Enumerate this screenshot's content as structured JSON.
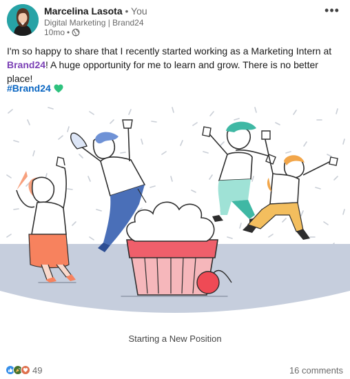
{
  "author": {
    "name": "Marcelina Lasota",
    "separator": "•",
    "degree": "You",
    "headline": "Digital Marketing | Brand24",
    "time": "10mo",
    "time_separator": "•",
    "visibility_icon": "globe-icon"
  },
  "menu": {
    "more_icon": "more-horizontal-icon",
    "more_label": "•••"
  },
  "post": {
    "text_before": "I'm so happy to share that I recently started working as a Marketing Intern at ",
    "mention": "Brand24",
    "text_after": "! A huge opportunity for me to learn and grow. There is no better place!",
    "hashtag": "#Brand24",
    "hashtag_icon": "green-heart-icon"
  },
  "card": {
    "caption": "Starting a New Position"
  },
  "social": {
    "reaction_icons": [
      "like-icon",
      "celebrate-icon",
      "love-icon"
    ],
    "reaction_count": "49",
    "comments": "16 comments"
  },
  "colors": {
    "mention": "#7a3fb5",
    "hashtag": "#0a66c2",
    "heart": "#2ec27e",
    "floor": "#c6cedd"
  }
}
